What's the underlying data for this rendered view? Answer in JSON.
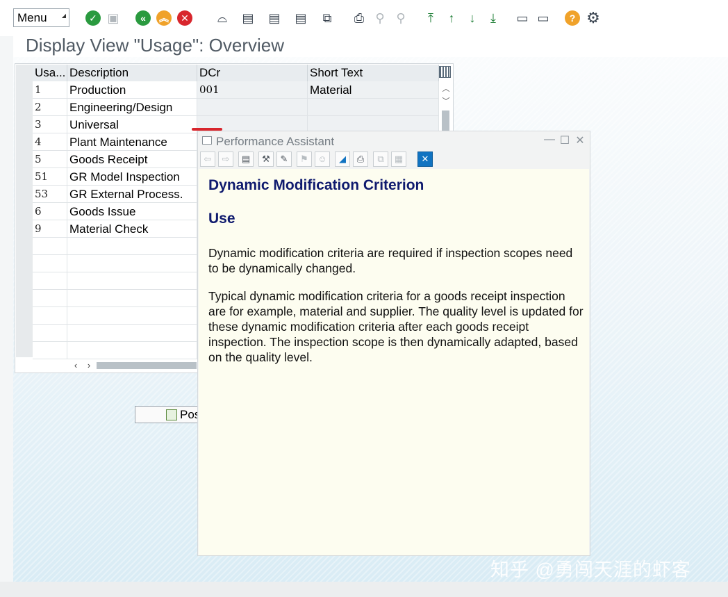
{
  "toolbar": {
    "menu_label": "Menu",
    "icons": [
      "enter-icon",
      "save-icon",
      "back-icon",
      "exit-icon",
      "cancel-icon",
      "glasses-icon",
      "display-icon",
      "select-all-icon",
      "deselect-icon",
      "compare-icon",
      "print-icon",
      "find-icon",
      "find-next-icon",
      "first-page-icon",
      "previous-page-icon",
      "next-page-icon",
      "last-page-icon",
      "create-session-icon",
      "shortcut-icon",
      "help-icon",
      "settings-icon"
    ]
  },
  "page": {
    "title": "Display View \"Usage\": Overview"
  },
  "table": {
    "columns": [
      "Usa...",
      "Description",
      "DCr",
      "Short Text"
    ],
    "rows": [
      {
        "key": "1",
        "description": "Production",
        "dcr": "001",
        "short_text": "Material"
      },
      {
        "key": "2",
        "description": "Engineering/Design",
        "dcr": "",
        "short_text": ""
      },
      {
        "key": "3",
        "description": "Universal",
        "dcr": "",
        "short_text": ""
      },
      {
        "key": "4",
        "description": "Plant Maintenance",
        "dcr": "",
        "short_text": ""
      },
      {
        "key": "5",
        "description": "Goods Receipt",
        "dcr": "",
        "short_text": ""
      },
      {
        "key": "51",
        "description": "GR Model Inspection",
        "dcr": "",
        "short_text": ""
      },
      {
        "key": "53",
        "description": "GR External Process.",
        "dcr": "",
        "short_text": ""
      },
      {
        "key": "6",
        "description": "Goods Issue",
        "dcr": "",
        "short_text": ""
      },
      {
        "key": "9",
        "description": "Material Check",
        "dcr": "",
        "short_text": ""
      }
    ]
  },
  "position_button": {
    "label": "Pos"
  },
  "performance_assistant": {
    "title": "Performance Assistant",
    "heading": "Dynamic Modification Criterion",
    "subheading": "Use",
    "paragraphs": [
      "Dynamic modification criteria are required if inspection scopes need to be dynamically changed.",
      "Typical dynamic modification criteria for a goods receipt inspection are for example, material and supplier. The quality level is updated for these dynamic modification criteria after each goods receipt inspection. The inspection scope is then dynamically adapted, based on the quality level."
    ]
  },
  "watermark": "知乎 @勇闯天涯的虾客",
  "colors": {
    "accent_green": "#2a9a3f",
    "accent_orange": "#f0a22a",
    "accent_red": "#d8262d",
    "heading_navy": "#0f1a6e",
    "popup_background": "#fdfdf0"
  }
}
